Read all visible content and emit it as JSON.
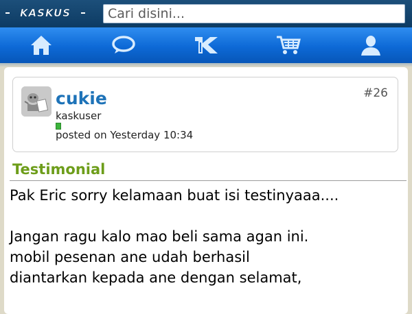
{
  "header": {
    "logo_text": "KASKUS",
    "search_placeholder": "Cari disini..."
  },
  "nav": {
    "items": [
      {
        "name": "home",
        "icon": "home-icon"
      },
      {
        "name": "messages",
        "icon": "speech-bubble-icon"
      },
      {
        "name": "kaskus",
        "icon": "kaskus-k-icon"
      },
      {
        "name": "jual-beli",
        "icon": "shopping-cart-icon"
      },
      {
        "name": "profile",
        "icon": "user-icon"
      }
    ]
  },
  "post": {
    "username": "cukie",
    "user_title": "kaskuser",
    "posted_on": "posted on Yesterday 10:34",
    "post_number": "#26",
    "status": "online"
  },
  "section": {
    "title": "Testimonial"
  },
  "message": {
    "text": "Pak Eric sorry kelamaan buat isi testinyaaa....\n\nJangan ragu kalo mao beli sama agan ini.\nmobil pesenan ane udah berhasil\ndiantarkan kepada ane dengan selamat,"
  },
  "colors": {
    "topbar": "#0d3b63",
    "navbar": "#0d69d6",
    "username": "#1e73b8",
    "section_title": "#6d9d1a",
    "online": "#3cb43c"
  }
}
